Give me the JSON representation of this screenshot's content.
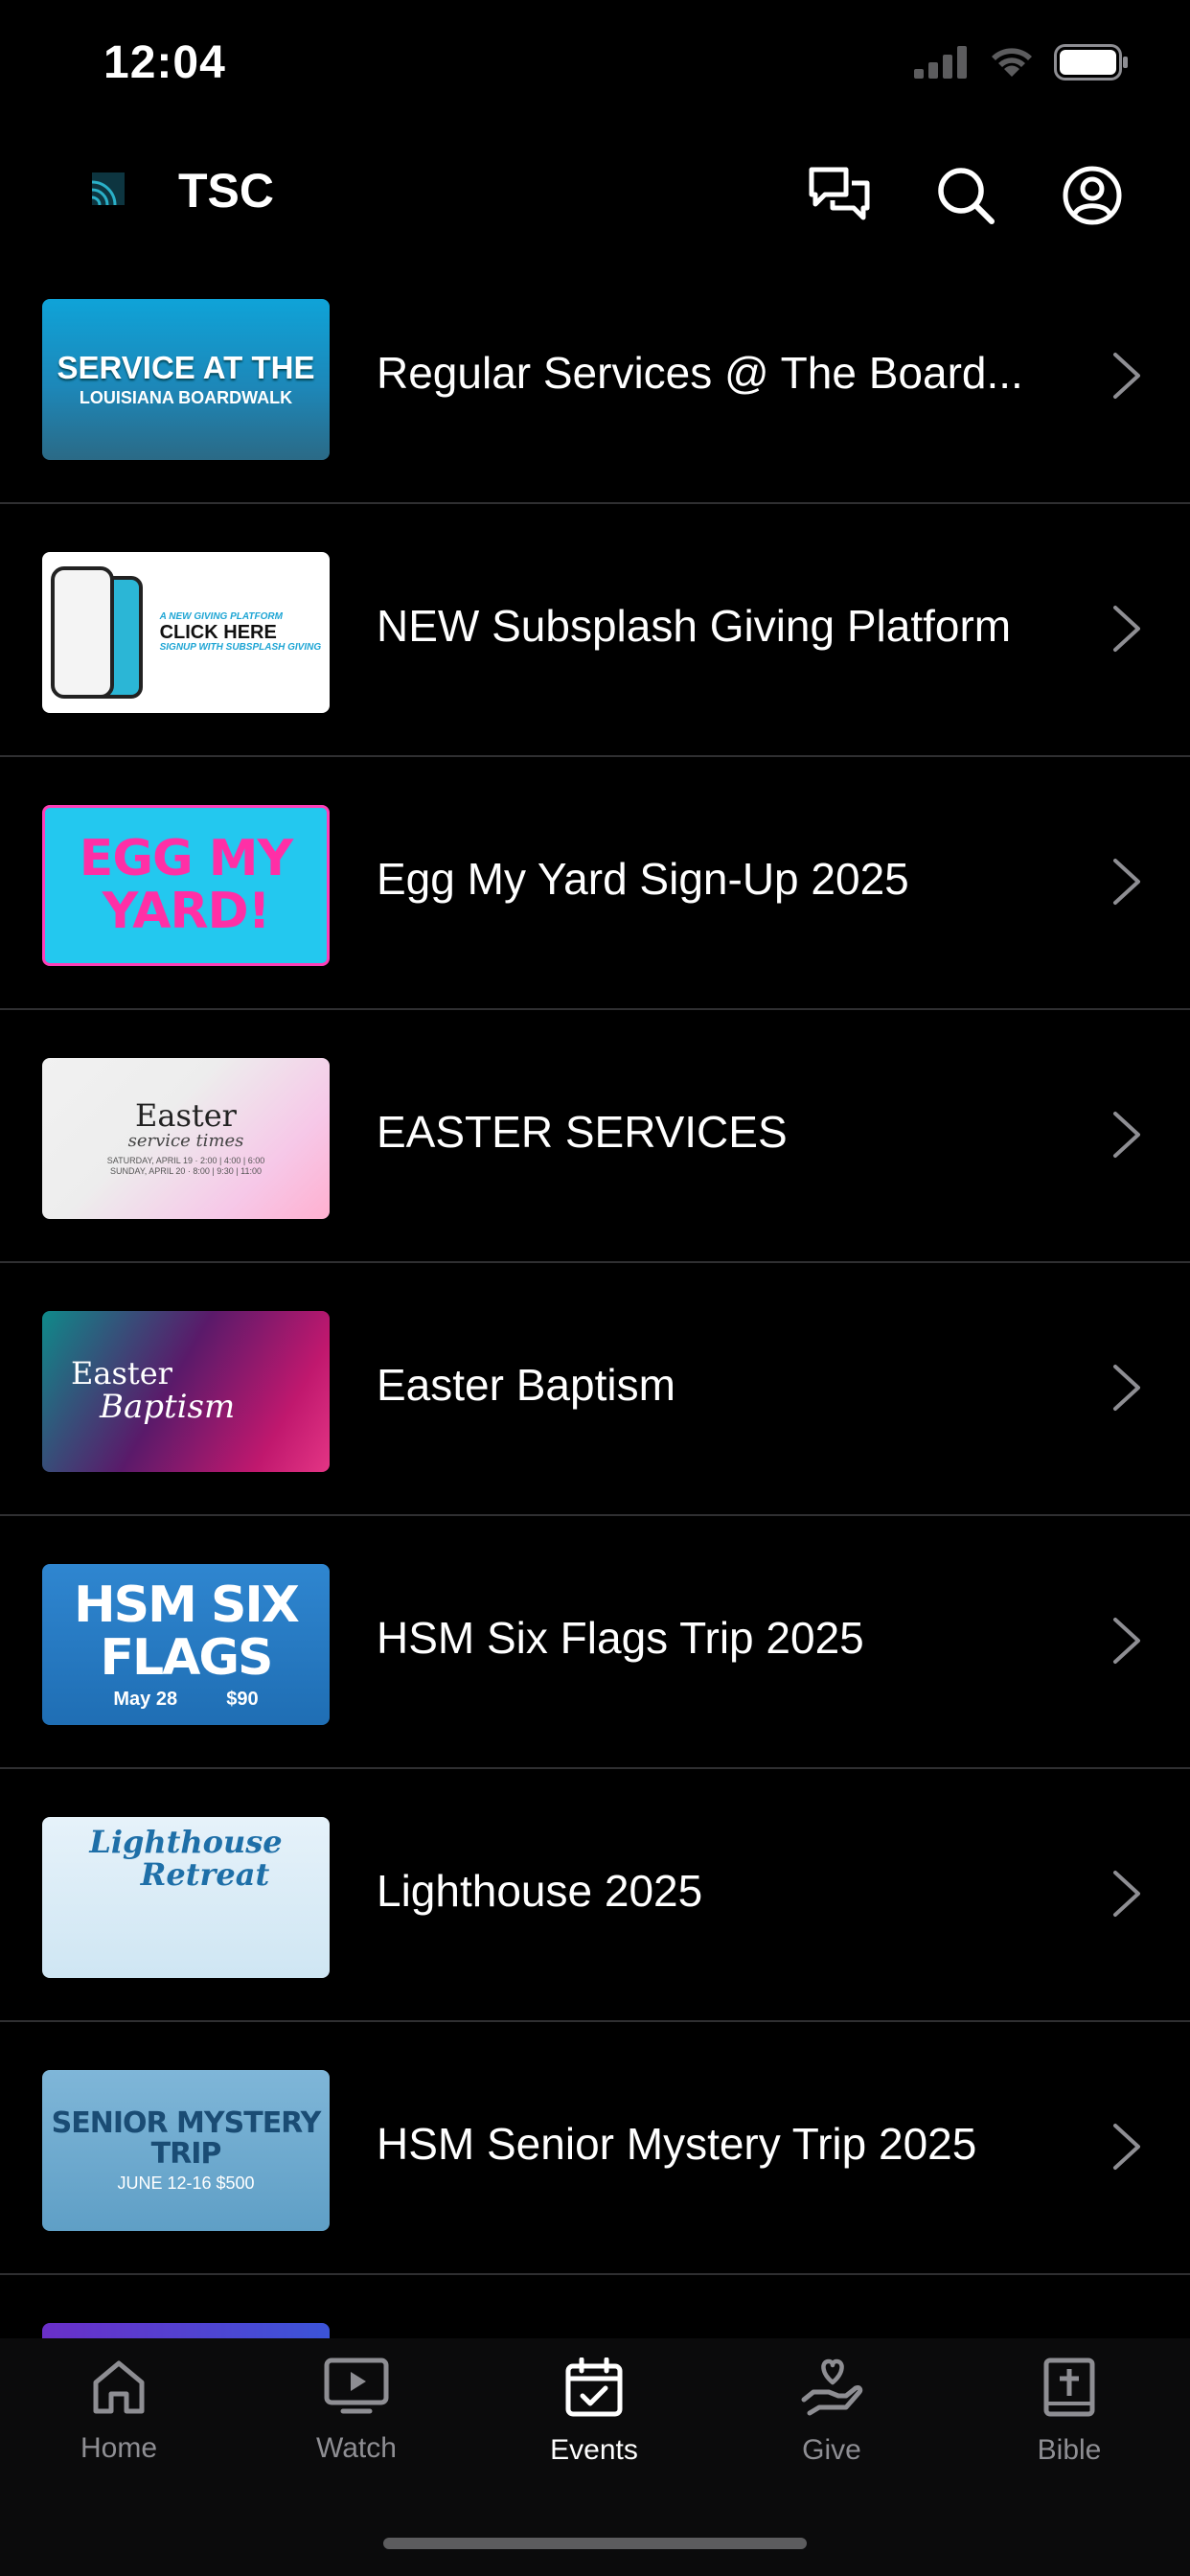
{
  "status_bar": {
    "time": "12:04"
  },
  "header": {
    "app_title": "TSC",
    "icons": [
      "chat-icon",
      "search-icon",
      "profile-icon"
    ]
  },
  "events": [
    {
      "title": "Regular Services @ The Board...",
      "thumb": {
        "line1": "SERVICE AT THE",
        "line2": "LOUISIANA BOARDWALK"
      }
    },
    {
      "title": "NEW Subsplash Giving Platform",
      "thumb": {
        "line1": "A NEW GIVING PLATFORM",
        "line2": "CLICK HERE",
        "line3": "SIGNUP WITH SUBSPLASH GIVING"
      }
    },
    {
      "title": "Egg My Yard Sign-Up 2025",
      "thumb": {
        "line1": "EGG MY YARD!"
      }
    },
    {
      "title": "EASTER SERVICES",
      "thumb": {
        "line1": "Easter",
        "line2": "service times",
        "line3": "SATURDAY, APRIL 19 · 2:00 | 4:00 | 6:00",
        "line4": "SUNDAY, APRIL 20 · 8:00 | 9:30 | 11:00"
      }
    },
    {
      "title": "Easter Baptism",
      "thumb": {
        "line1": "Easter",
        "line2": "Baptism"
      }
    },
    {
      "title": "HSM Six Flags Trip 2025",
      "thumb": {
        "line1": "HSM SIX",
        "line2": "FLAGS",
        "line3": "May 28",
        "line4": "$90"
      }
    },
    {
      "title": "Lighthouse 2025",
      "thumb": {
        "line1": "Lighthouse",
        "line2": "Retreat"
      }
    },
    {
      "title": "HSM Senior Mystery Trip 2025",
      "thumb": {
        "line1": "SENIOR MYSTERY TRIP",
        "line2": "JUNE 12-16 $500"
      }
    }
  ],
  "tabs": [
    {
      "label": "Home",
      "icon": "home-icon",
      "active": false
    },
    {
      "label": "Watch",
      "icon": "watch-icon",
      "active": false
    },
    {
      "label": "Events",
      "icon": "calendar-icon",
      "active": true
    },
    {
      "label": "Give",
      "icon": "give-icon",
      "active": false
    },
    {
      "label": "Bible",
      "icon": "bible-icon",
      "active": false
    }
  ],
  "colors": {
    "background": "#000000",
    "divider": "#2f2f31",
    "tab_inactive": "#8e8e93",
    "tab_active": "#ffffff",
    "chevron": "#8e8e93"
  }
}
